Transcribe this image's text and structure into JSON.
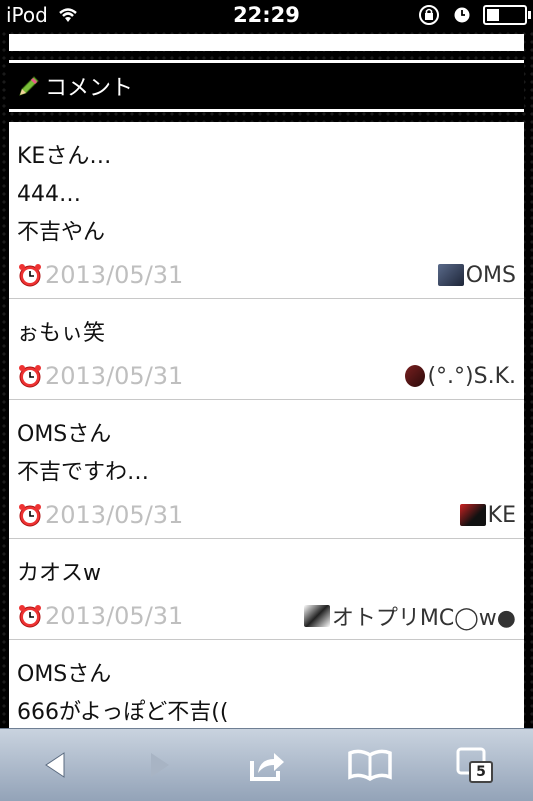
{
  "status_bar": {
    "carrier": "iPod",
    "time": "22:29"
  },
  "section": {
    "title": "コメント"
  },
  "comments": [
    {
      "lines": [
        "KEさん…",
        "444…",
        "不吉やん"
      ],
      "date": "2013/05/31",
      "author": "OMS"
    },
    {
      "lines": [
        "ぉもぃ笑"
      ],
      "date": "2013/05/31",
      "author": "(°.°)S.K."
    },
    {
      "lines": [
        "OMSさん",
        "不吉ですわ…"
      ],
      "date": "2013/05/31",
      "author": "KE"
    },
    {
      "lines": [
        "カオスw"
      ],
      "date": "2013/05/31",
      "author": "オトプリMC◯w●"
    },
    {
      "lines": [
        "OMSさん",
        "666がよっぽど不吉(("
      ],
      "date": "",
      "author": ""
    }
  ],
  "toolbar": {
    "tab_count": "5"
  },
  "colors": {
    "date_text": "#bfbfbf",
    "toolbar_top": "#c9d3df",
    "toolbar_bottom": "#93a3b8"
  }
}
